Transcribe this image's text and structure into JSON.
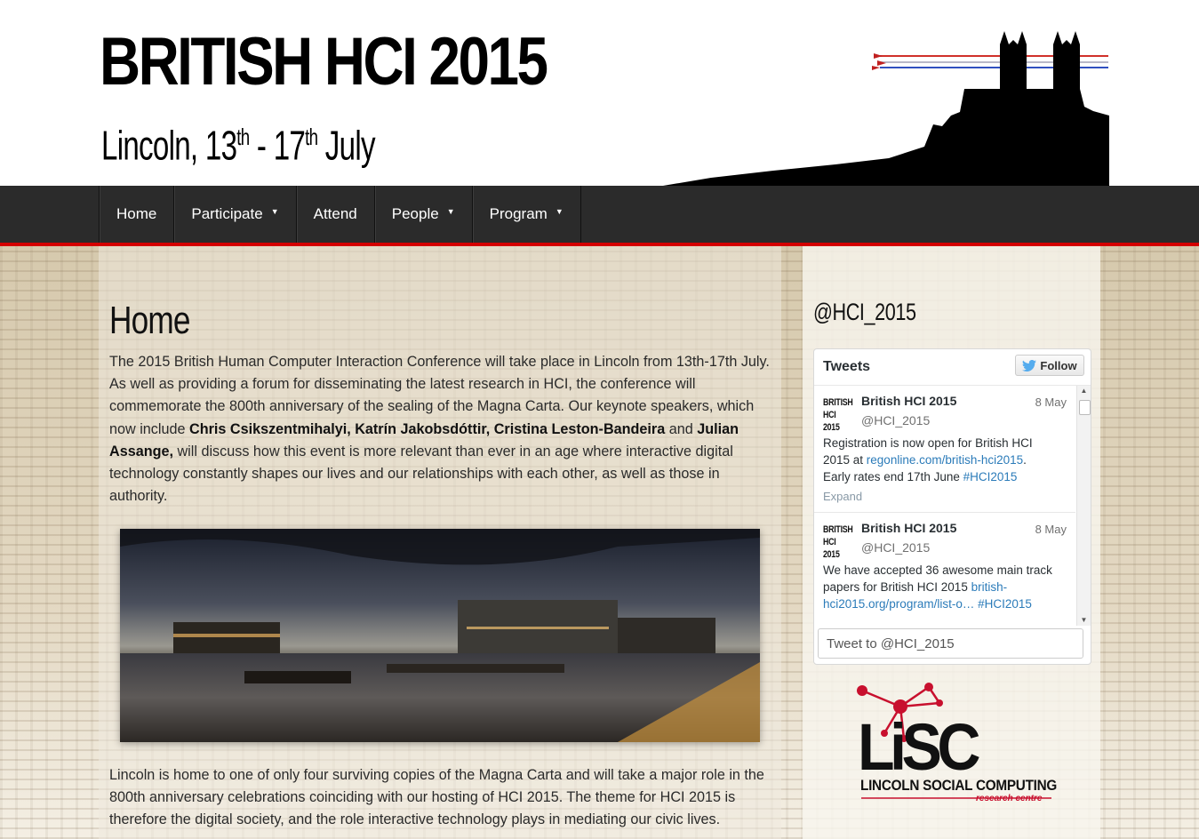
{
  "header": {
    "title": "BRITISH HCI 2015",
    "subtitle_prefix": "Lincoln, 13",
    "subtitle_sup1": "th",
    "subtitle_mid": " - 17",
    "subtitle_sup2": "th",
    "subtitle_suffix": " July"
  },
  "nav": {
    "items": [
      {
        "label": "Home",
        "dropdown": false
      },
      {
        "label": "Participate",
        "dropdown": true
      },
      {
        "label": "Attend",
        "dropdown": false
      },
      {
        "label": "People",
        "dropdown": true
      },
      {
        "label": "Program",
        "dropdown": true
      }
    ],
    "caret": "▼"
  },
  "main": {
    "title": "Home",
    "intro": {
      "text1": "The 2015 British Human Computer Interaction Conference will take place in Lincoln from 13th-17th July. As well as providing a forum for disseminating the latest research in HCI, the conference will commemorate the 800th anniversary of the sealing of the Magna Carta. Our keynote speakers, which now include ",
      "bold1": "Chris Csikszentmihalyi, Katrín Jakobsdóttir, Cristina Leston-Bandeira",
      "text2": " and ",
      "bold2": "Julian Assange,",
      "text3": " will discuss how this event is more relevant than ever in an age where interactive digital technology constantly shapes our lives and our relationships with each other, as well as those in authority."
    },
    "para2": "Lincoln is home to one of only four surviving copies of the Magna Carta and will take a major role in the 800th anniversary celebrations coinciding with our hosting of HCI 2015. The theme for HCI 2015 is therefore the digital society, and the role interactive technology plays in mediating our civic lives."
  },
  "sidebar": {
    "heading": "@HCI_2015",
    "widget": {
      "title": "Tweets",
      "follow_label": "Follow",
      "tweets": [
        {
          "avatar_line1": "BRITISH",
          "avatar_line2": "HCI 2015",
          "name": "British HCI 2015",
          "handle": "@HCI_2015",
          "date": "8 May",
          "text_before": "Registration is now open for British HCI 2015 at ",
          "link1": "regonline.com/british-hci2015",
          "text_mid": ". Early rates end 17th June ",
          "link2": "#HCI2015",
          "expand": "Expand"
        },
        {
          "avatar_line1": "BRITISH",
          "avatar_line2": "HCI 2015",
          "name": "British HCI 2015",
          "handle": "@HCI_2015",
          "date": "8 May",
          "text_before": "We have accepted 36 awesome main track papers for British HCI 2015 ",
          "link1": "british-hci2015.org/program/list-o…",
          "link2": "#HCI2015"
        }
      ],
      "tweet_box_placeholder": "Tweet to @HCI_2015"
    },
    "logo": {
      "letters": "LiSC",
      "name": "LINCOLN SOCIAL COMPUTING",
      "tagline": "research centre"
    }
  },
  "colors": {
    "nav_bg": "#2b2b2b",
    "nav_accent": "#d40000",
    "link": "#2b7bb9",
    "logo_red": "#c8102e"
  }
}
